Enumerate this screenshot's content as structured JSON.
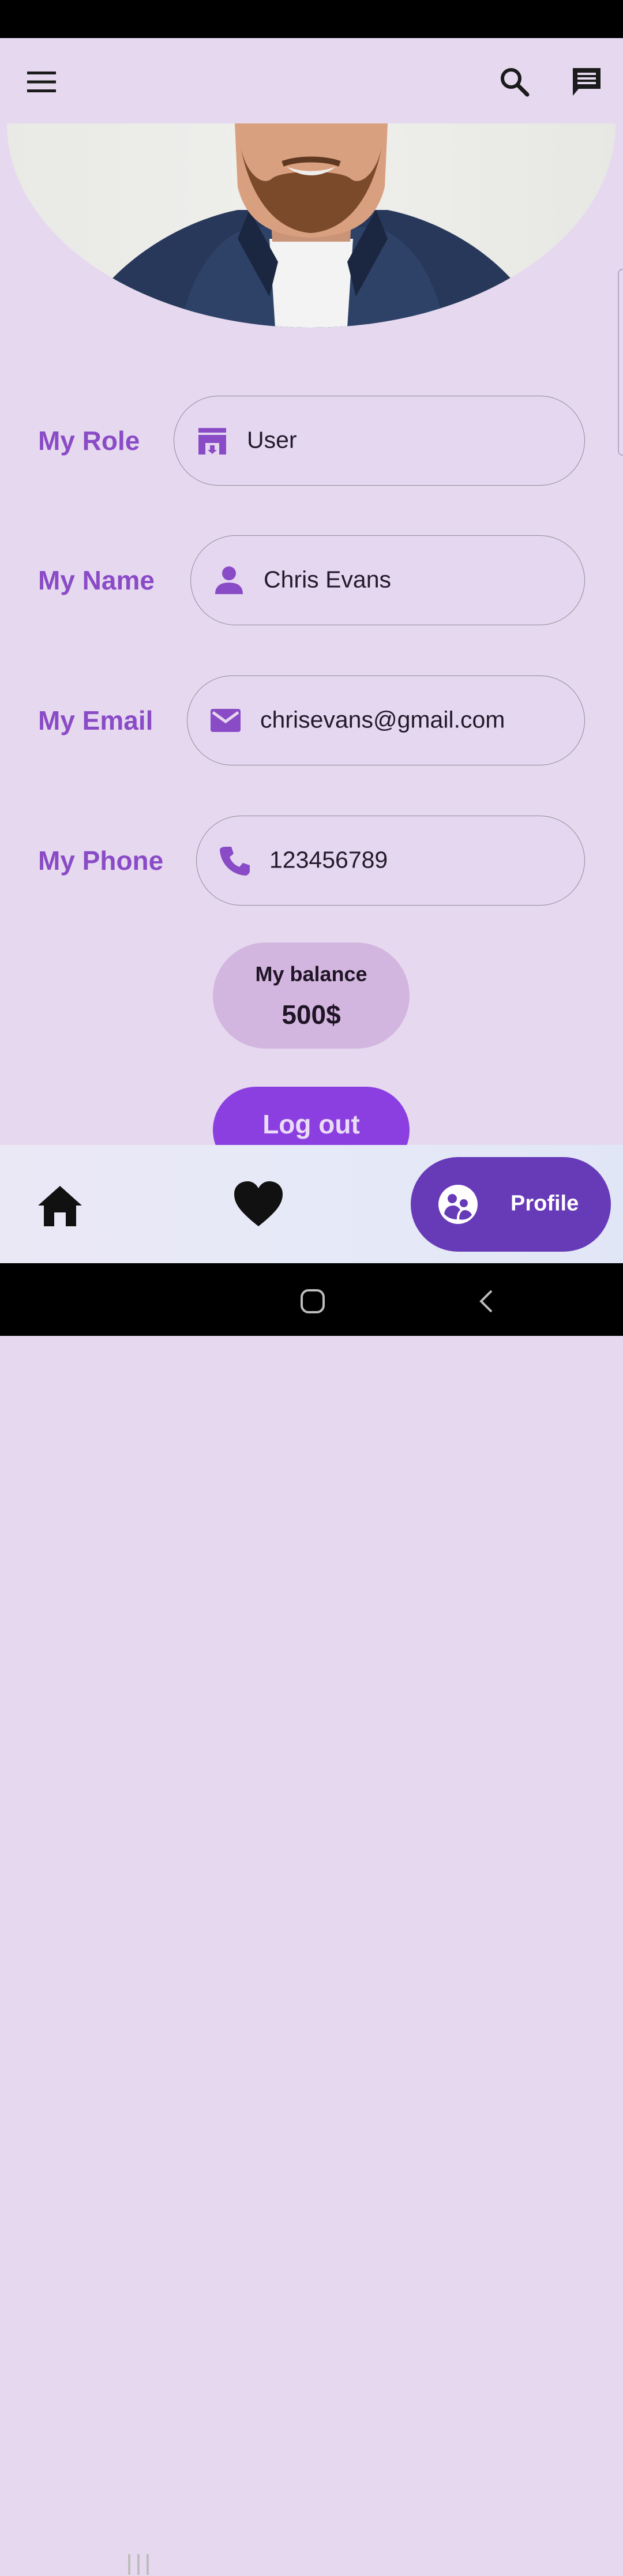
{
  "appbar": {
    "icons": [
      "menu-icon",
      "search-icon",
      "chat-icon"
    ]
  },
  "profile": {
    "role": {
      "label": "My Role",
      "value": "User",
      "icon": "store-icon"
    },
    "name": {
      "label": "My Name",
      "value": "Chris Evans",
      "icon": "person-icon"
    },
    "email": {
      "label": "My Email",
      "value": "chrisevans@gmail.com",
      "icon": "mail-icon"
    },
    "phone": {
      "label": "My Phone",
      "value": "123456789",
      "icon": "phone-icon"
    }
  },
  "balance": {
    "label": "My balance",
    "value": "500$"
  },
  "logout": {
    "label": "Log out"
  },
  "bottom_nav": {
    "items": [
      {
        "icon": "home-icon"
      },
      {
        "icon": "heart-icon"
      },
      {
        "icon": "profile-icon",
        "label": "Profile",
        "active": true
      }
    ]
  },
  "colors": {
    "accent": "#8a4bc6",
    "logout_bg": "#8c3fe0",
    "balance_bg": "#d3b6df",
    "nav_active_bg": "#673ab7",
    "background": "#e6d9ef"
  }
}
